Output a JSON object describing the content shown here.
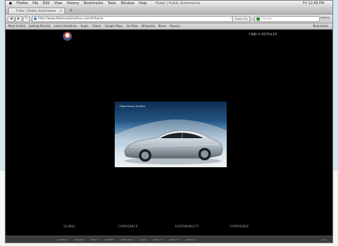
{
  "menu": {
    "app": "Firefox",
    "items": [
      "File",
      "Edit",
      "View",
      "History",
      "Bookmarks",
      "Tools",
      "Window",
      "Help"
    ],
    "window_title": "Fisker | Public Automotive",
    "clock": "Fri 12:48 PM"
  },
  "tab": {
    "title": "Fisker | Public Automotive"
  },
  "nav": {
    "url": "http://www.fiskerautomotive.com/#/home",
    "site_button": "Fisker Co",
    "search_placeholder": "Google",
    "home_label": "Home"
  },
  "bookmarks": {
    "items": [
      "Most Visited",
      "Getting Started",
      "Latest Headlines",
      "Apple",
      "Yahoo!",
      "Google Maps",
      "YouTube",
      "Wikipedia",
      "News",
      "Popular"
    ],
    "right": "Bookmarks"
  },
  "site": {
    "top_link": "FIND A RETAILER",
    "hero_heading": "Fisker Karma EcoChic",
    "footer_nav": [
      "GLOBAL",
      "CONFIDENCE",
      "SUSTAINABILITY",
      "EXPERIENCE"
    ],
    "sub_nav": [
      "COMPANY",
      "DEALERS",
      "MEDIA",
      "CAREERS",
      "INVESTORS",
      "LEGAL",
      "PRIVACY",
      "CONTACT",
      "SITEMAP"
    ],
    "status_right": "Done"
  },
  "colors": {
    "page_background": "#000000",
    "link_text": "#cfcfcf",
    "frame_background": "#d3e6ee"
  }
}
